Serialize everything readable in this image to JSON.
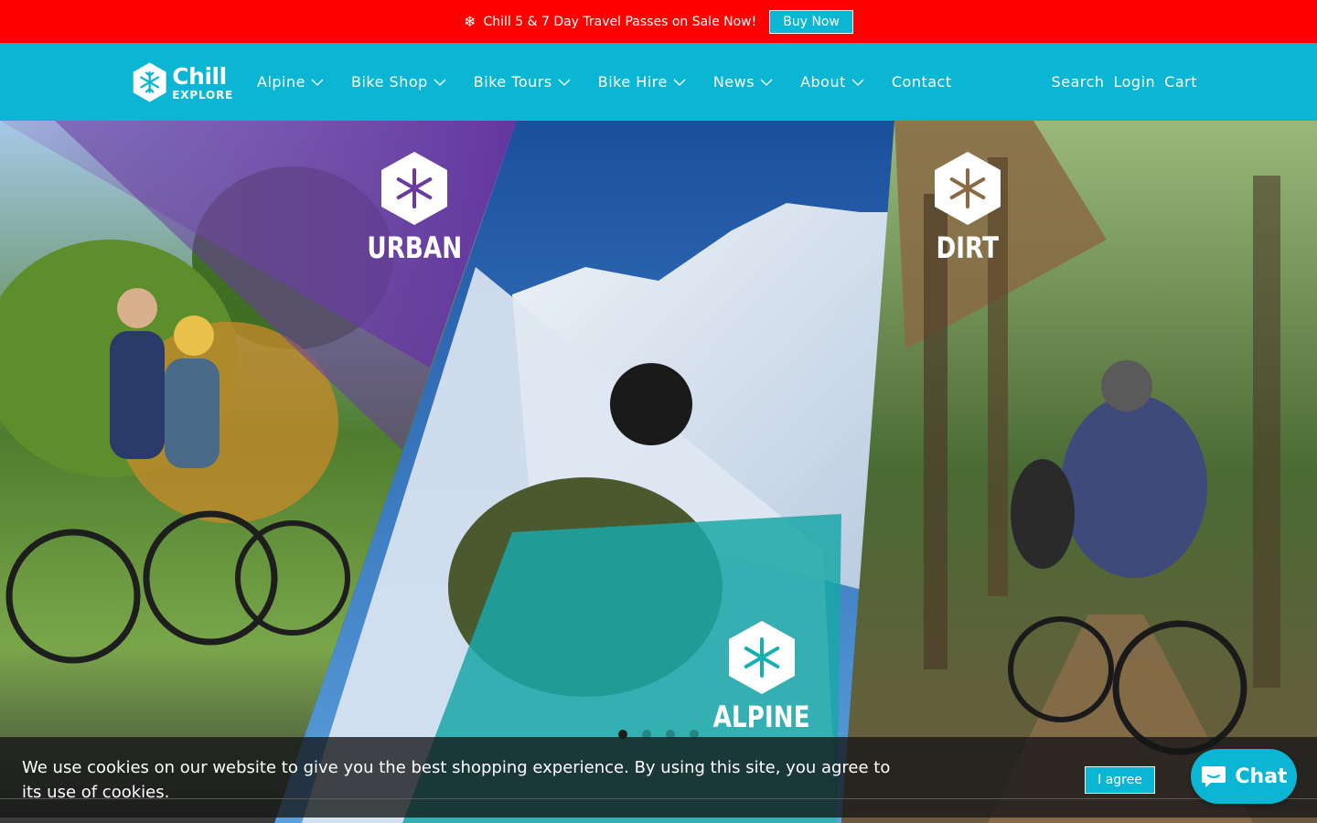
{
  "announcement": {
    "text": "Chill 5 & 7 Day Travel Passes on Sale Now!",
    "button_label": "Buy Now",
    "icon": "snowflake-icon"
  },
  "header": {
    "logo": {
      "line1": "Chill",
      "line2": "EXPLORE"
    },
    "nav": [
      {
        "label": "Alpine",
        "has_dropdown": true
      },
      {
        "label": "Bike Shop",
        "has_dropdown": true
      },
      {
        "label": "Bike Tours",
        "has_dropdown": true
      },
      {
        "label": "Bike Hire",
        "has_dropdown": true
      },
      {
        "label": "News",
        "has_dropdown": true
      },
      {
        "label": "About",
        "has_dropdown": true
      },
      {
        "label": "Contact",
        "has_dropdown": false
      }
    ],
    "utility": {
      "search": "Search",
      "login": "Login",
      "cart": "Cart"
    }
  },
  "hero": {
    "badges": {
      "urban": "URBAN",
      "dirt": "DIRT",
      "alpine": "ALPINE"
    },
    "slides": 4,
    "active_slide": 1
  },
  "cookie": {
    "text": "We use cookies on our website to give you the best shopping experience. By using this site, you agree to its use of cookies.",
    "button_label": "I agree"
  },
  "chat": {
    "label": "Chat"
  },
  "colors": {
    "announcement_bg": "#ff0000",
    "brand_teal": "#0ab6d4",
    "urban_purple": "#6a3aa0",
    "alpine_teal": "#17b0b0",
    "dirt_brown": "#8a6a44"
  }
}
